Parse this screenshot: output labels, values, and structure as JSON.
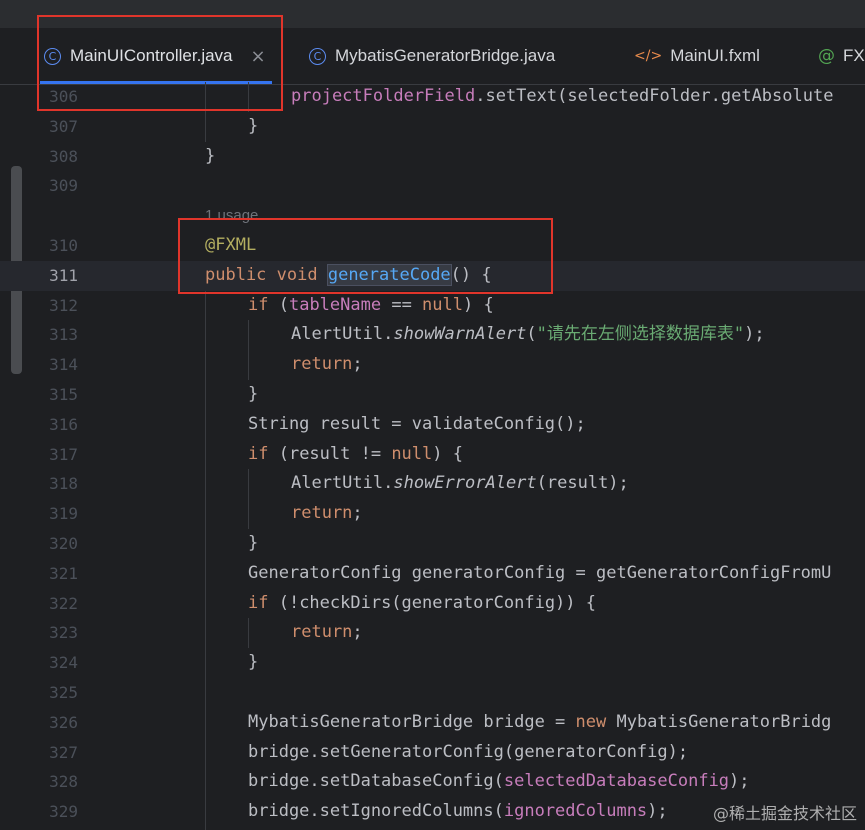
{
  "tabs": [
    {
      "label": "MainUIController.java",
      "icon": "class-icon",
      "active": true
    },
    {
      "label": "MybatisGeneratorBridge.java",
      "icon": "class-icon",
      "active": false
    },
    {
      "label": "MainUI.fxml",
      "icon": "xml-icon",
      "active": false
    },
    {
      "label": "FX",
      "icon": "annotation-icon",
      "active": false
    }
  ],
  "tab_close_symbol": "×",
  "icon_glyphs": {
    "class": "C",
    "xml": "</>",
    "annotation": "@"
  },
  "editor": {
    "usage_hint": "1 usage",
    "current_line": "311",
    "lines": [
      {
        "n": "306",
        "text": "projectFolderField.setText(selectedFolder.getAbsolute"
      },
      {
        "n": "307",
        "text": "}"
      },
      {
        "n": "308",
        "text": "}"
      },
      {
        "n": "309",
        "text": ""
      },
      {
        "n": "310",
        "text": "@FXML"
      },
      {
        "n": "311",
        "text": "public void generateCode() {"
      },
      {
        "n": "312",
        "text": "if (tableName == null) {"
      },
      {
        "n": "313",
        "text": "AlertUtil.showWarnAlert(\"请先在左侧选择数据库表\");"
      },
      {
        "n": "314",
        "text": "return;"
      },
      {
        "n": "315",
        "text": "}"
      },
      {
        "n": "316",
        "text": "String result = validateConfig();"
      },
      {
        "n": "317",
        "text": "if (result != null) {"
      },
      {
        "n": "318",
        "text": "AlertUtil.showErrorAlert(result);"
      },
      {
        "n": "319",
        "text": "return;"
      },
      {
        "n": "320",
        "text": "}"
      },
      {
        "n": "321",
        "text": "GeneratorConfig generatorConfig = getGeneratorConfigFromU"
      },
      {
        "n": "322",
        "text": "if (!checkDirs(generatorConfig)) {"
      },
      {
        "n": "323",
        "text": "return;"
      },
      {
        "n": "324",
        "text": "}"
      },
      {
        "n": "325",
        "text": ""
      },
      {
        "n": "326",
        "text": "MybatisGeneratorBridge bridge = new MybatisGeneratorBridg"
      },
      {
        "n": "327",
        "text": "bridge.setGeneratorConfig(generatorConfig);"
      },
      {
        "n": "328",
        "text": "bridge.setDatabaseConfig(selectedDatabaseConfig);"
      },
      {
        "n": "329",
        "text": "bridge.setIgnoredColumns(ignoredColumns);"
      }
    ]
  },
  "watermark": "@稀土掘金技术社区",
  "colors": {
    "background": "#1e1f22",
    "keyword": "#cf8e6d",
    "annotation": "#b3ae60",
    "method": "#56a8f5",
    "field": "#c77dbb",
    "string": "#6aab73",
    "highlight_box": "#e0352b"
  }
}
